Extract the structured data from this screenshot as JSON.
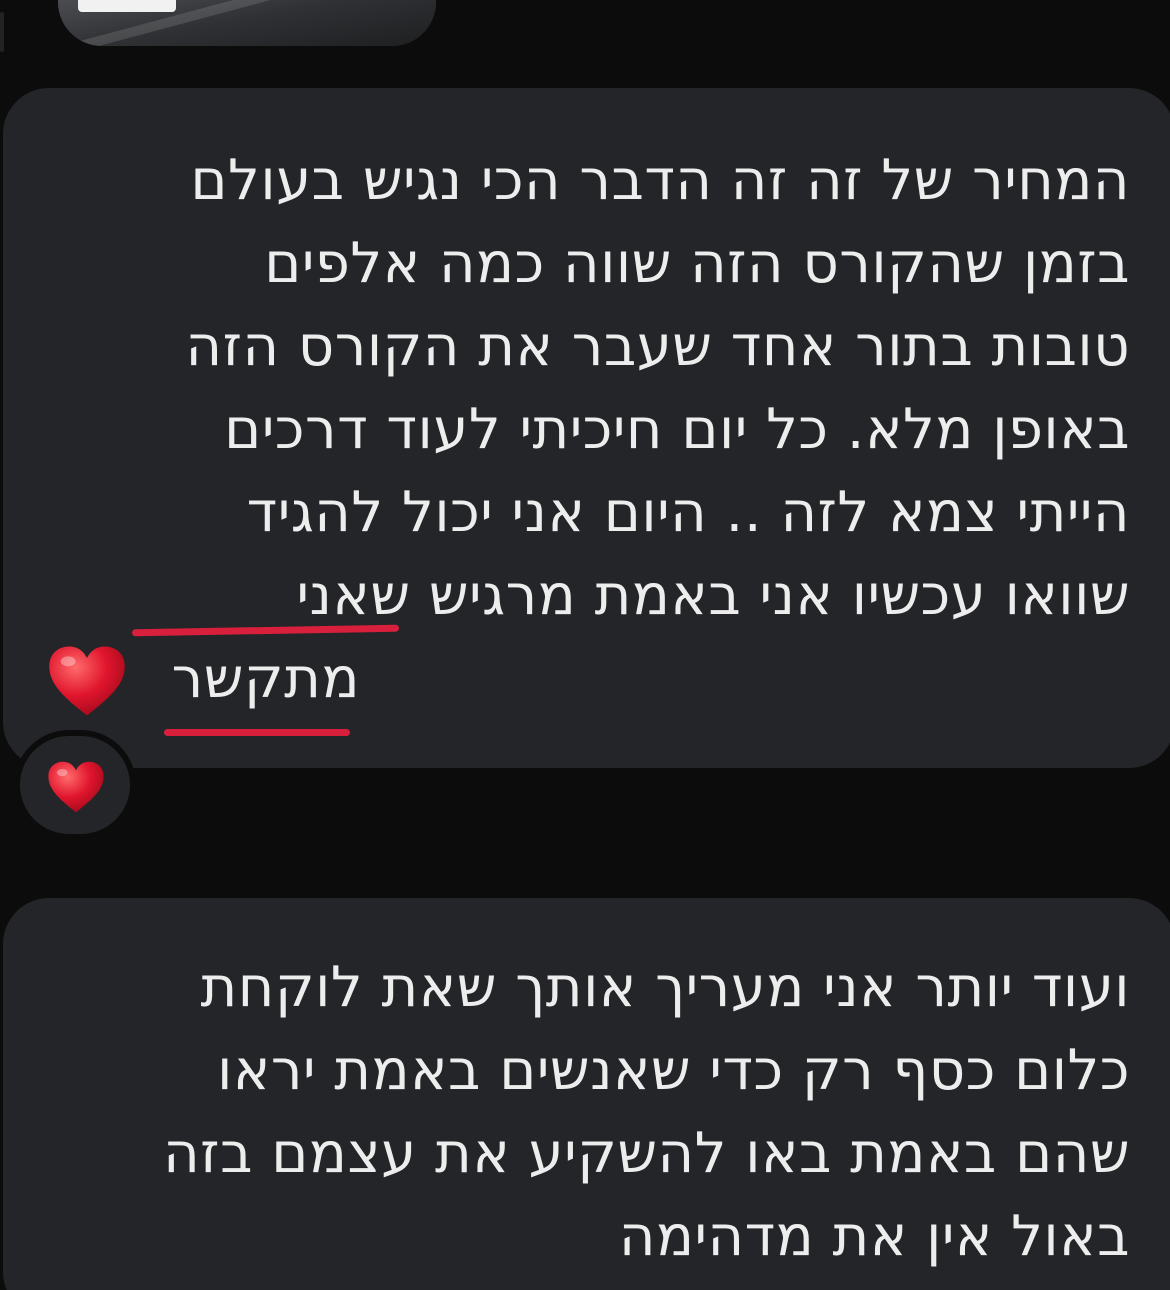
{
  "thread": {
    "attachment": {
      "kind": "image-preview",
      "icon": "photo-thumbnail-icon"
    },
    "message_1": {
      "lines": [
        "המחיר של זה זה הדבר הכי נגיש בעולם",
        "בזמן שהקורס הזה שווה כמה אלפים",
        "טובות בתור אחד שעבר את הקורס הזה",
        "באופן מלא. כל יום חיכיתי לעוד דרכים",
        "הייתי צמא לזה .. היום אני יכול להגיד",
        "שוואו עכשיו אני באמת מרגיש שאני",
        "מתקשר"
      ],
      "emoji": "❤️",
      "emoji_icon": "red-heart-icon",
      "highlight_color": "#d8203c",
      "reaction": {
        "emoji": "❤️",
        "icon": "red-heart-icon"
      }
    },
    "message_2": {
      "lines": [
        "ועוד יותר אני מעריך אותך שאת לוקחת",
        "כלום כסף רק כדי שאנשים באמת יראו",
        "שהם באמת באו להשקיע את עצמם בזה",
        "באול אין את מדהימה"
      ]
    }
  },
  "colors": {
    "background": "#0c0c0d",
    "bubble": "#242528",
    "text": "#ededed",
    "heart": "#e0152d"
  }
}
